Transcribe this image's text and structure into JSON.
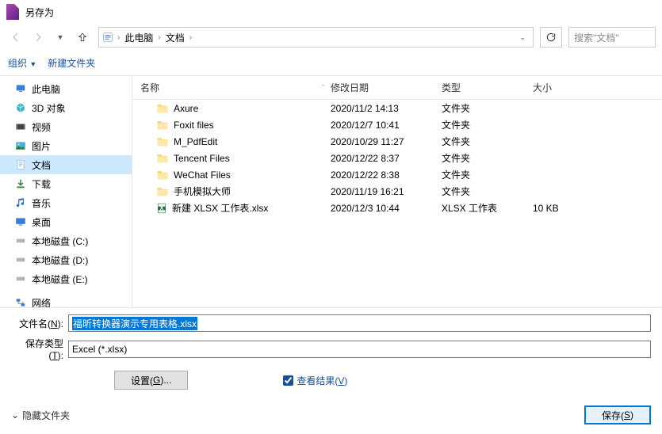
{
  "title": "另存为",
  "breadcrumb": {
    "root": "此电脑",
    "current": "文档"
  },
  "search": {
    "placeholder": "搜索\"文档\""
  },
  "toolbar": {
    "organize": "组织",
    "new_folder": "新建文件夹"
  },
  "sidebar": {
    "items": [
      {
        "label": "此电脑",
        "icon": "pc"
      },
      {
        "label": "3D 对象",
        "icon": "3d"
      },
      {
        "label": "视频",
        "icon": "video"
      },
      {
        "label": "图片",
        "icon": "image"
      },
      {
        "label": "文档",
        "icon": "doc",
        "selected": true
      },
      {
        "label": "下载",
        "icon": "download"
      },
      {
        "label": "音乐",
        "icon": "music"
      },
      {
        "label": "桌面",
        "icon": "desktop"
      },
      {
        "label": "本地磁盘 (C:)",
        "icon": "disk"
      },
      {
        "label": "本地磁盘 (D:)",
        "icon": "disk"
      },
      {
        "label": "本地磁盘 (E:)",
        "icon": "disk"
      },
      {
        "label": "网络",
        "icon": "network"
      }
    ]
  },
  "filelist": {
    "headers": {
      "name": "名称",
      "date": "修改日期",
      "type": "类型",
      "size": "大小"
    },
    "rows": [
      {
        "name": "Axure",
        "date": "2020/11/2 14:13",
        "type": "文件夹",
        "size": "",
        "icon": "folder"
      },
      {
        "name": "Foxit files",
        "date": "2020/12/7 10:41",
        "type": "文件夹",
        "size": "",
        "icon": "folder"
      },
      {
        "name": "M_PdfEdit",
        "date": "2020/10/29 11:27",
        "type": "文件夹",
        "size": "",
        "icon": "folder"
      },
      {
        "name": "Tencent Files",
        "date": "2020/12/22 8:37",
        "type": "文件夹",
        "size": "",
        "icon": "folder"
      },
      {
        "name": "WeChat Files",
        "date": "2020/12/22 8:38",
        "type": "文件夹",
        "size": "",
        "icon": "folder"
      },
      {
        "name": "手机模拟大师",
        "date": "2020/11/19 16:21",
        "type": "文件夹",
        "size": "",
        "icon": "folder"
      },
      {
        "name": "新建 XLSX 工作表.xlsx",
        "date": "2020/12/3 10:44",
        "type": "XLSX 工作表",
        "size": "10 KB",
        "icon": "xlsx"
      }
    ]
  },
  "footer": {
    "filename_label": "文件名(N):",
    "filename_value": "福昕转换器演示专用表格.xlsx",
    "filetype_label": "保存类型(T):",
    "filetype_value": "Excel (*.xlsx)",
    "settings_btn": "设置(G)...",
    "view_result": "查看结果(V)",
    "hide_folders": "隐藏文件夹",
    "save_btn": "保存(S)"
  }
}
